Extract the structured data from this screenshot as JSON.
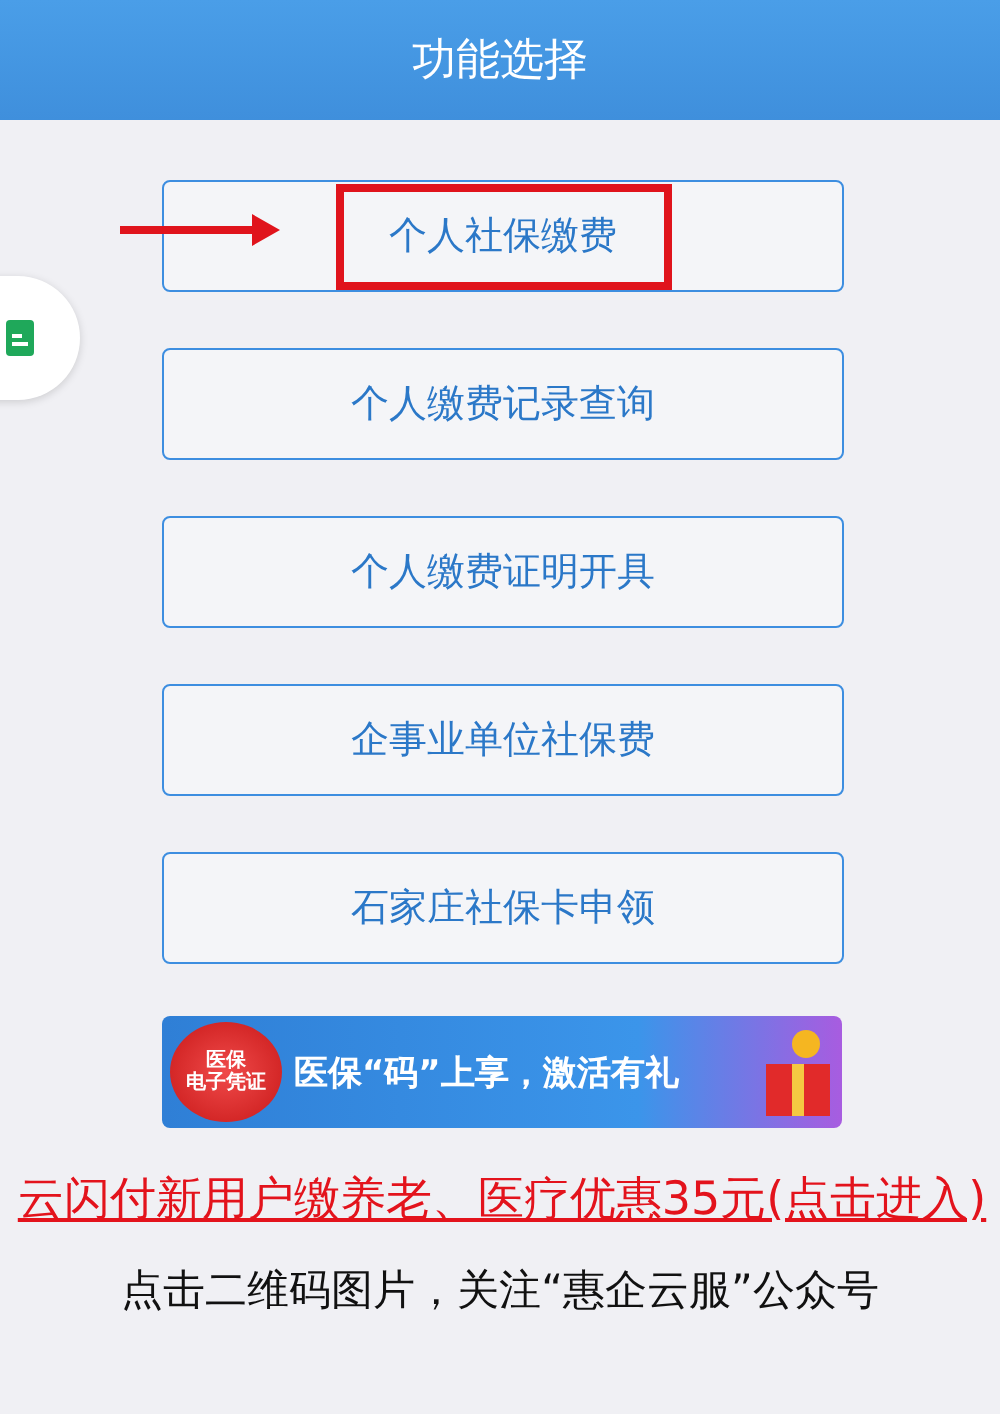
{
  "header": {
    "title": "功能选择"
  },
  "menu": [
    {
      "label": "个人社保缴费",
      "highlighted": true
    },
    {
      "label": "个人缴费记录查询",
      "highlighted": false
    },
    {
      "label": "个人缴费证明开具",
      "highlighted": false
    },
    {
      "label": "企事业单位社保费",
      "highlighted": false
    },
    {
      "label": "石家庄社保卡申领",
      "highlighted": false
    }
  ],
  "banner": {
    "badge_line_1": "医保",
    "badge_line_2": "电子凭证",
    "headline": "医保“码”上享，激活有礼"
  },
  "promo_link": "云闪付新用户缴养老、医疗优惠35元(点击进入)",
  "footer_text": "点击二维码图片，关注“惠企云服”公众号"
}
